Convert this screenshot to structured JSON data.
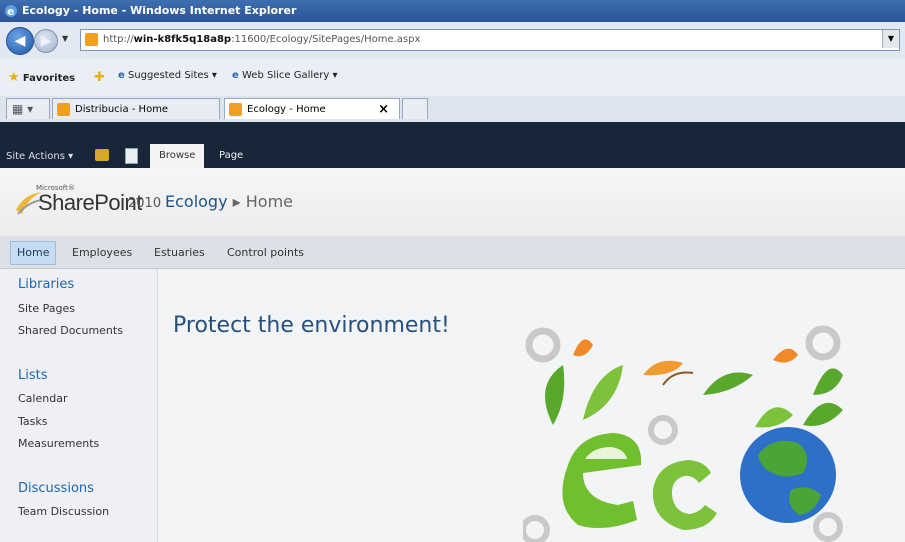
{
  "window": {
    "title": "Ecology - Home - Windows Internet Explorer"
  },
  "address": {
    "prefix": "http://",
    "host": "win-k8fk5q18a8p",
    "path": ":11600/Ecology/SitePages/Home.aspx"
  },
  "favorites_bar": {
    "favorites": "Favorites",
    "suggested": "Suggested Sites ▾",
    "webslice": "Web Slice Gallery ▾"
  },
  "tabs": [
    {
      "label": "Distribucia - Home"
    },
    {
      "label": "Ecology - Home"
    }
  ],
  "ribbon": {
    "site_actions": "Site Actions ▾",
    "browse": "Browse",
    "page": "Page"
  },
  "logo": {
    "microsoft": "Microsoft®",
    "product": "SharePoint",
    "year": "2010"
  },
  "breadcrumb": {
    "site": "Ecology",
    "sep": " ▸ ",
    "page": "Home"
  },
  "topnav": [
    "Home",
    "Employees",
    "Estuaries",
    "Control points"
  ],
  "quicklaunch": {
    "libraries": "Libraries",
    "library_items": [
      "Site Pages",
      "Shared Documents"
    ],
    "lists": "Lists",
    "list_items": [
      "Calendar",
      "Tasks",
      "Measurements"
    ],
    "discussions": "Discussions",
    "discussion_items": [
      "Team Discussion"
    ]
  },
  "main": {
    "title": "Protect the environment!"
  },
  "colors": {
    "accent": "#1d5487",
    "ribbon": "#18263a",
    "titlebar": "#2a5496"
  }
}
